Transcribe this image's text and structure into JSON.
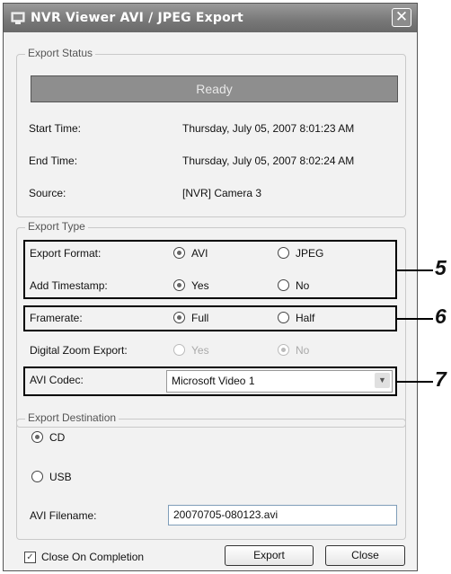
{
  "window": {
    "title": "NVR Viewer AVI / JPEG Export",
    "close_glyph": "✕"
  },
  "export_status": {
    "legend": "Export Status",
    "status": "Ready",
    "start_time_label": "Start Time:",
    "start_time_value": "Thursday, July 05, 2007 8:01:23 AM",
    "end_time_label": "End Time:",
    "end_time_value": "Thursday, July 05, 2007 8:02:24 AM",
    "source_label": "Source:",
    "source_value": "[NVR] Camera 3"
  },
  "export_type": {
    "legend": "Export Type",
    "format_label": "Export Format:",
    "format_options": [
      "AVI",
      "JPEG"
    ],
    "format_selected": "AVI",
    "timestamp_label": "Add Timestamp:",
    "timestamp_options": [
      "Yes",
      "No"
    ],
    "timestamp_selected": "Yes",
    "framerate_label": "Framerate:",
    "framerate_options": [
      "Full",
      "Half"
    ],
    "framerate_selected": "Full",
    "zoom_label": "Digital Zoom Export:",
    "zoom_options": [
      "Yes",
      "No"
    ],
    "zoom_selected": "No",
    "codec_label": "AVI Codec:",
    "codec_value": "Microsoft Video 1"
  },
  "export_destination": {
    "legend": "Export Destination",
    "options": [
      "CD",
      "USB"
    ],
    "selected": "CD",
    "filename_label": "AVI Filename:",
    "filename_value": "20070705-080123.avi"
  },
  "footer": {
    "close_on_completion_label": "Close On Completion",
    "close_on_completion_checked": true,
    "export_button": "Export",
    "close_button": "Close"
  },
  "callouts": [
    "5",
    "6",
    "7"
  ]
}
